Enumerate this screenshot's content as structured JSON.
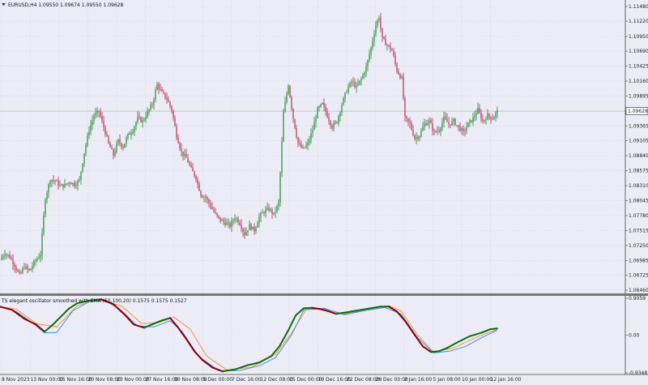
{
  "window": {
    "symbol_header": "EURUSD,H4  1.09550 1.09674 1.09550 1.09628",
    "current_price_tag": "1.09628"
  },
  "price_axis": {
    "ticks": [
      "1.11480",
      "1.11220",
      "1.10950",
      "1.10690",
      "1.10425",
      "1.10160",
      "1.09895",
      "1.09628",
      "1.09365",
      "1.09105",
      "1.08840",
      "1.08575",
      "1.08310",
      "1.08045",
      "1.07780",
      "1.07515",
      "1.07250",
      "1.06985",
      "1.06725",
      "1.06460"
    ]
  },
  "indicator": {
    "header": "TS elegant oscillator smoothed with EMA (50,100,20) 0.1575 0.1575 0.1527",
    "ticks": [
      "0.9059",
      "0.00",
      "-0.9348"
    ]
  },
  "time_axis": {
    "ticks": [
      "8 Nov 2023",
      "13 Nov 00:00",
      "15 Nov 16:00",
      "20 Nov 08:00",
      "23 Nov 00:00",
      "27 Nov 16:00",
      "30 Nov 08:00",
      "5 Dec 00:00",
      "7 Dec 16:00",
      "12 Dec 08:00",
      "15 Dec 00:00",
      "19 Dec 16:00",
      "22 Dec 08:00",
      "28 Dec 00:00",
      "2 Jan 16:00",
      "5 Jan 08:00",
      "10 Jan 00:00",
      "12 Jan 16:00"
    ]
  },
  "colors": {
    "background": "#ececf7",
    "grid": "#d4d4e6",
    "bull_candle": "#1f8a2c",
    "bear_candle": "#b03050",
    "price_line": "#b5c4a0",
    "osc_up": "#0a6e0a",
    "osc_down": "#8b0000",
    "signal_blue": "#3a8ef0",
    "signal_orange": "#f0943a",
    "separator": "#777777"
  },
  "chart_data": {
    "type": "candlestick",
    "symbol": "EURUSD",
    "timeframe": "H4",
    "last": {
      "open": 1.0955,
      "high": 1.09674,
      "low": 1.0955,
      "close": 1.09628
    },
    "ylim": [
      1.0646,
      1.1148
    ],
    "close_path": [
      [
        0,
        1.07
      ],
      [
        6,
        1.0712
      ],
      [
        12,
        1.0705
      ],
      [
        18,
        1.069
      ],
      [
        24,
        1.0672
      ],
      [
        30,
        1.0688
      ],
      [
        36,
        1.068
      ],
      [
        42,
        1.0694
      ],
      [
        50,
        1.071
      ],
      [
        56,
        1.081
      ],
      [
        62,
        1.0842
      ],
      [
        68,
        1.084
      ],
      [
        74,
        1.083
      ],
      [
        80,
        1.0832
      ],
      [
        86,
        1.0838
      ],
      [
        92,
        1.0833
      ],
      [
        98,
        1.084
      ],
      [
        104,
        1.089
      ],
      [
        110,
        1.093
      ],
      [
        116,
        1.0955
      ],
      [
        122,
        1.0962
      ],
      [
        128,
        1.0935
      ],
      [
        134,
        1.0905
      ],
      [
        140,
        1.0885
      ],
      [
        146,
        1.091
      ],
      [
        152,
        1.09
      ],
      [
        158,
        1.092
      ],
      [
        164,
        1.093
      ],
      [
        170,
        1.095
      ],
      [
        176,
        1.0945
      ],
      [
        182,
        1.096
      ],
      [
        188,
        1.0975
      ],
      [
        194,
        1.101
      ],
      [
        200,
        1.0995
      ],
      [
        206,
        1.0985
      ],
      [
        212,
        1.0965
      ],
      [
        218,
        1.092
      ],
      [
        224,
        1.089
      ],
      [
        230,
        1.088
      ],
      [
        236,
        1.086
      ],
      [
        242,
        1.0845
      ],
      [
        248,
        1.0815
      ],
      [
        254,
        1.081
      ],
      [
        260,
        1.0795
      ],
      [
        266,
        1.078
      ],
      [
        272,
        1.077
      ],
      [
        278,
        1.0765
      ],
      [
        284,
        1.076
      ],
      [
        290,
        1.0775
      ],
      [
        296,
        1.0765
      ],
      [
        302,
        1.0745
      ],
      [
        308,
        1.076
      ],
      [
        314,
        1.0752
      ],
      [
        320,
        1.0775
      ],
      [
        326,
        1.0785
      ],
      [
        332,
        1.079
      ],
      [
        338,
        1.078
      ],
      [
        344,
        1.08
      ],
      [
        350,
        1.096
      ],
      [
        356,
        1.101
      ],
      [
        362,
        1.095
      ],
      [
        368,
        1.0905
      ],
      [
        374,
        1.0895
      ],
      [
        380,
        1.0905
      ],
      [
        386,
        1.093
      ],
      [
        392,
        1.0965
      ],
      [
        398,
        1.0975
      ],
      [
        404,
        1.0955
      ],
      [
        410,
        1.0935
      ],
      [
        416,
        1.0945
      ],
      [
        422,
        1.0975
      ],
      [
        428,
        1.1
      ],
      [
        434,
        1.1015
      ],
      [
        440,
        1.1005
      ],
      [
        446,
        1.102
      ],
      [
        452,
        1.104
      ],
      [
        458,
        1.1075
      ],
      [
        464,
        1.1115
      ],
      [
        468,
        1.113
      ],
      [
        472,
        1.109
      ],
      [
        478,
        1.108
      ],
      [
        484,
        1.107
      ],
      [
        490,
        1.1035
      ],
      [
        496,
        1.102
      ],
      [
        500,
        1.095
      ],
      [
        506,
        1.094
      ],
      [
        512,
        1.0915
      ],
      [
        518,
        1.092
      ],
      [
        524,
        1.094
      ],
      [
        530,
        1.0945
      ],
      [
        536,
        1.0925
      ],
      [
        542,
        1.093
      ],
      [
        548,
        1.095
      ],
      [
        554,
        1.094
      ],
      [
        560,
        1.0945
      ],
      [
        566,
        1.0935
      ],
      [
        572,
        1.0925
      ],
      [
        578,
        1.094
      ],
      [
        584,
        1.095
      ],
      [
        590,
        1.0965
      ],
      [
        596,
        1.0945
      ],
      [
        602,
        1.0955
      ],
      [
        608,
        1.095
      ],
      [
        614,
        1.09628
      ]
    ],
    "oscillator": {
      "ylim": [
        -0.9348,
        0.9059
      ],
      "main": [
        [
          0,
          0.7
        ],
        [
          15,
          0.62
        ],
        [
          30,
          0.4
        ],
        [
          45,
          0.25
        ],
        [
          55,
          0.08
        ],
        [
          65,
          0.25
        ],
        [
          75,
          0.45
        ],
        [
          85,
          0.65
        ],
        [
          95,
          0.78
        ],
        [
          110,
          0.85
        ],
        [
          125,
          0.88
        ],
        [
          140,
          0.76
        ],
        [
          155,
          0.48
        ],
        [
          165,
          0.26
        ],
        [
          178,
          0.18
        ],
        [
          190,
          0.28
        ],
        [
          200,
          0.36
        ],
        [
          210,
          0.42
        ],
        [
          220,
          0.18
        ],
        [
          230,
          -0.1
        ],
        [
          240,
          -0.4
        ],
        [
          250,
          -0.62
        ],
        [
          262,
          -0.8
        ],
        [
          275,
          -0.9
        ],
        [
          290,
          -0.85
        ],
        [
          305,
          -0.75
        ],
        [
          320,
          -0.68
        ],
        [
          335,
          -0.52
        ],
        [
          345,
          -0.28
        ],
        [
          355,
          0.08
        ],
        [
          365,
          0.48
        ],
        [
          375,
          0.66
        ],
        [
          385,
          0.67
        ],
        [
          395,
          0.64
        ],
        [
          405,
          0.59
        ],
        [
          415,
          0.52
        ],
        [
          425,
          0.55
        ],
        [
          440,
          0.6
        ],
        [
          455,
          0.65
        ],
        [
          470,
          0.7
        ],
        [
          480,
          0.7
        ],
        [
          490,
          0.58
        ],
        [
          500,
          0.35
        ],
        [
          512,
          0.0
        ],
        [
          522,
          -0.28
        ],
        [
          532,
          -0.42
        ],
        [
          542,
          -0.4
        ],
        [
          552,
          -0.32
        ],
        [
          565,
          -0.18
        ],
        [
          580,
          -0.03
        ],
        [
          595,
          0.06
        ],
        [
          605,
          0.14
        ],
        [
          614,
          0.16
        ]
      ],
      "blue": [
        [
          0,
          0.7
        ],
        [
          20,
          0.58
        ],
        [
          40,
          0.3
        ],
        [
          55,
          0.05
        ],
        [
          70,
          0.06
        ],
        [
          90,
          0.6
        ],
        [
          110,
          0.82
        ],
        [
          130,
          0.86
        ],
        [
          150,
          0.6
        ],
        [
          170,
          0.22
        ],
        [
          190,
          0.2
        ],
        [
          210,
          0.35
        ],
        [
          225,
          0.08
        ],
        [
          245,
          -0.52
        ],
        [
          270,
          -0.88
        ],
        [
          295,
          -0.88
        ],
        [
          320,
          -0.76
        ],
        [
          340,
          -0.56
        ],
        [
          360,
          0.0
        ],
        [
          375,
          0.62
        ],
        [
          400,
          0.66
        ],
        [
          425,
          0.5
        ],
        [
          450,
          0.6
        ],
        [
          475,
          0.68
        ],
        [
          495,
          0.52
        ],
        [
          515,
          -0.05
        ],
        [
          535,
          -0.44
        ],
        [
          555,
          -0.4
        ],
        [
          575,
          -0.28
        ],
        [
          595,
          -0.06
        ],
        [
          614,
          0.12
        ]
      ],
      "orange": [
        [
          0,
          0.7
        ],
        [
          20,
          0.64
        ],
        [
          45,
          0.28
        ],
        [
          70,
          0.2
        ],
        [
          95,
          0.72
        ],
        [
          120,
          0.88
        ],
        [
          150,
          0.72
        ],
        [
          175,
          0.28
        ],
        [
          195,
          0.3
        ],
        [
          215,
          0.44
        ],
        [
          235,
          0.14
        ],
        [
          255,
          -0.52
        ],
        [
          280,
          -0.86
        ],
        [
          310,
          -0.8
        ],
        [
          340,
          -0.48
        ],
        [
          360,
          0.05
        ],
        [
          378,
          0.63
        ],
        [
          400,
          0.64
        ],
        [
          425,
          0.52
        ],
        [
          455,
          0.64
        ],
        [
          480,
          0.72
        ],
        [
          495,
          0.6
        ],
        [
          515,
          0.02
        ],
        [
          535,
          -0.42
        ],
        [
          560,
          -0.32
        ],
        [
          590,
          -0.04
        ],
        [
          614,
          0.14
        ]
      ]
    }
  }
}
